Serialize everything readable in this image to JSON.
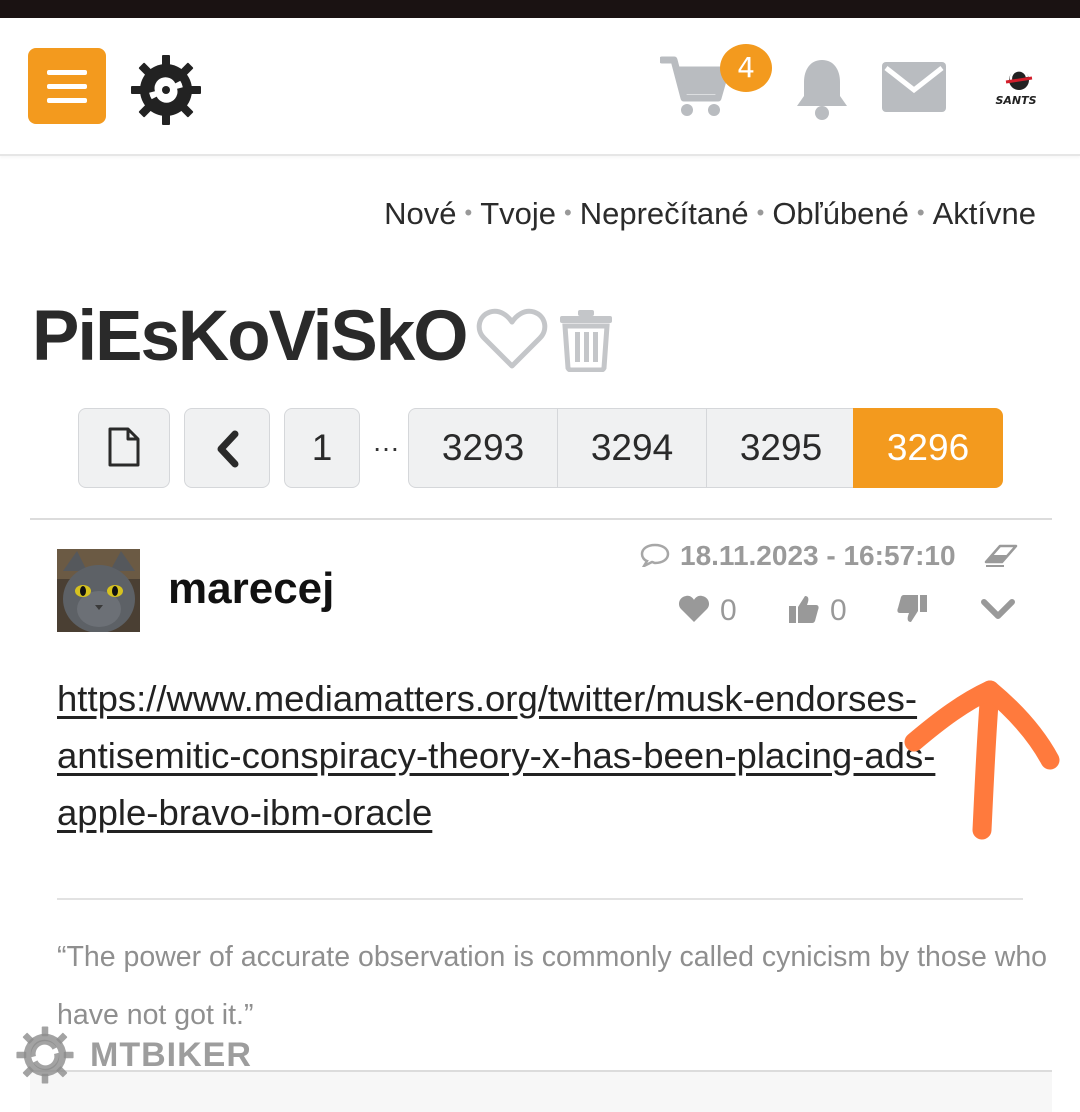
{
  "header": {
    "menu_icon": "hamburger-icon",
    "logo_icon": "mtbiker-gear-logo",
    "cart_icon": "cart-icon",
    "cart_count": "4",
    "bell_icon": "bell-icon",
    "mail_icon": "mail-icon",
    "user_avatar": "Santa Cruz (SANTS) avatar",
    "avatar_text": "SANTS"
  },
  "subnav": {
    "items": [
      "Nové",
      "Tvoje",
      "Neprečítané",
      "Obľúbené",
      "Aktívne"
    ],
    "separator": "•"
  },
  "thread": {
    "title": "PiEsKoViSkO"
  },
  "pagination": {
    "first_icon": "page-icon",
    "prev_icon": "chevron-left-icon",
    "first_page": "1",
    "ellipsis": "…",
    "pages": [
      "3293",
      "3294",
      "3295",
      "3296"
    ],
    "active_page": "3296"
  },
  "post": {
    "username": "marecej",
    "datetime": "18.11.2023 - 16:57:10",
    "hearts": "0",
    "likes": "0",
    "link": "https://www.mediamatters.org/twitter/musk-endorses-antisemitic-conspiracy-theory-x-has-been-placing-ads-apple-bravo-ibm-oracle",
    "signature": "“The power of accurate observation is commonly called cynicism by those who have not got it.”"
  },
  "watermark": {
    "text": "MTBIKER"
  },
  "colors": {
    "accent": "#f39a1e",
    "arrow_annotation": "#ff7a3d",
    "icon_gray": "#b9bcc0"
  }
}
